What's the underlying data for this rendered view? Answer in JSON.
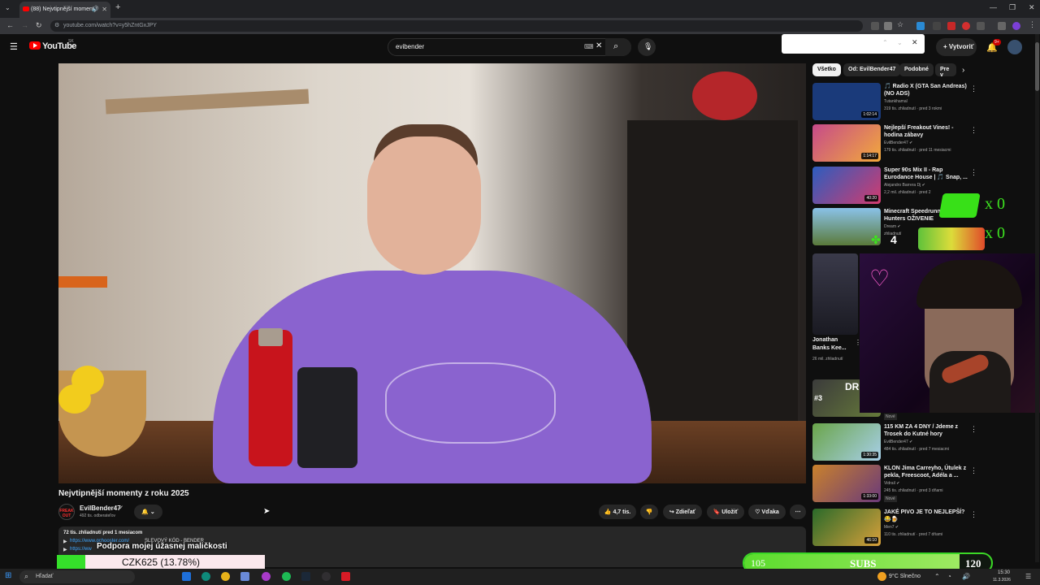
{
  "browser": {
    "tab_title": "(88) Nejvtipnější momenty",
    "url": "youtube.com/watch?v=y5hZntGxJPY"
  },
  "youtube": {
    "logo_text": "YouTube",
    "logo_country": "SK",
    "search_value": "evibender",
    "create_label": "Vytvoriť",
    "notif_count": "9+"
  },
  "video": {
    "title": "Nejvtipnější momenty z roku 2025",
    "channel": "EvilBender47",
    "subscribers": "492 tis. odberateľov",
    "avatar_text": "FREAK OUT",
    "likes": "4,7 tis.",
    "share_label": "Zdieľať",
    "save_label": "Uložiť",
    "thanks_label": "Vďaka",
    "views_date": "72 tis. zhliadnutí  pred 1 mesiacom",
    "desc_link1": "https://www.gchooster.com/",
    "desc_link1_suffix": " SLEVOVÝ KÓD - BENDER",
    "desc_link2": "https://ww"
  },
  "overlays": {
    "support_text": "Podpora mojej úžasnej maličkosti",
    "czk_text": "CZK625 (13.78%)",
    "czk_progress": 0.1378,
    "subs_left": "105",
    "subs_label": "SUBS",
    "subs_right": "120",
    "counter1": "x 0",
    "counter2": "x 0",
    "counter3": "4"
  },
  "chips": [
    "Všetko",
    "Od: EvilBender47",
    "Podobné",
    "Pre v"
  ],
  "sidebar": [
    {
      "title": "🎵 Radio X (GTA San Andreas) (NO ADS)",
      "channel": "Tutankhamal",
      "meta": "319 tis. zhliadnutí · pred 3 rokmi",
      "duration": "1:02:14",
      "thumb": "#1a3a7a"
    },
    {
      "title": "Nejlepší Freakout Vines! - hodina zábavy",
      "channel": "EvilBender47 ✔",
      "meta": "179 tis. zhliadnutí · pred 11 mesiacmi",
      "duration": "1:14:17",
      "thumb": "#c64a8a"
    },
    {
      "title": "Super 90s Mix II - Rap Eurodance House | 🎵 Snap, ...",
      "channel": "Alejandro Barrera Dj ✔",
      "meta": "2,2 mil. zhliadnutí · pred 2",
      "duration": "40:20",
      "thumb": "#2c5dbf"
    },
    {
      "title": "Minecraft Speedrunner VS 5 Hunters OŽIVENIE",
      "channel": "Dream ✔",
      "meta": "zhliadnutí",
      "duration": "",
      "thumb": "#5a7a3a"
    },
    {
      "title": "115 KM ZA 4 DNY / Jdeme z Trosek do Kutné hory",
      "channel": "EvilBender47 ✔",
      "meta": "484 tis. zhliadnutí · pred 7 mesiacmi",
      "duration": "1:30:35",
      "thumb": "#6aa54a"
    },
    {
      "title": "KLON Jima Carreyho, Útulek z pekla, Freescoot, Adéla a ...",
      "channel": "Vidrail ✔",
      "meta": "245 tis. zhliadnutí · pred 3 dňami",
      "duration": "1:33:00",
      "thumb": "#c9812c"
    },
    {
      "title": "JAKÉ PIVO JE TO NEJLEPŠÍ? 😂🍺",
      "channel": "Men7 ✔",
      "meta": "110 tis. zhliadnutí · pred 7 dňami",
      "duration": "46:10",
      "thumb": "#2a6a2a"
    }
  ],
  "short_card": {
    "title": "Jonathan Banks Kee...",
    "views": "26 mil. zhliadnutí",
    "badge": "Nové",
    "badge2": "Nové",
    "overlay": "DRI",
    "rank": "#3"
  },
  "taskbar": {
    "search_placeholder": "Hľadať",
    "weather": "9°C  Slnečno",
    "time": "15:30",
    "date": "11.3.2026"
  }
}
